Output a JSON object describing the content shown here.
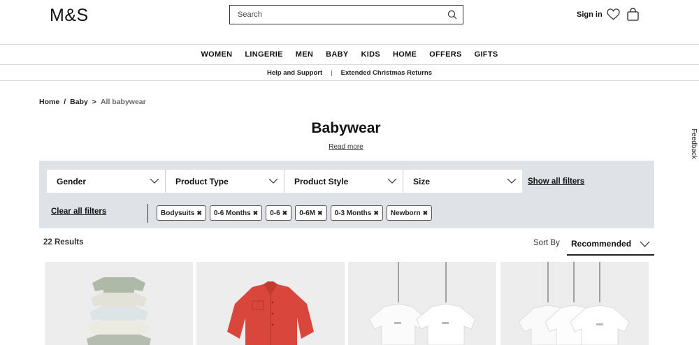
{
  "header": {
    "logo": "M&S",
    "search_placeholder": "Search",
    "sign_in": "Sign in"
  },
  "nav": {
    "items": [
      "WOMEN",
      "LINGERIE",
      "MEN",
      "BABY",
      "KIDS",
      "HOME",
      "OFFERS",
      "GIFTS"
    ]
  },
  "subnav": {
    "help": "Help and Support",
    "returns": "Extended Christmas Returns"
  },
  "breadcrumb": {
    "home": "Home",
    "sep1": "/",
    "baby": "Baby",
    "sep2": ">",
    "current": "All babywear"
  },
  "page": {
    "title": "Babywear",
    "read_more": "Read more",
    "feedback": "Feedback"
  },
  "filters": {
    "dropdowns": [
      "Gender",
      "Product Type",
      "Product Style",
      "Size"
    ],
    "show_all": "Show all filters",
    "clear_all": "Clear all filters",
    "chips": [
      "Bodysuits",
      "0-6 Months",
      "0-6",
      "0-6M",
      "0-3 Months",
      "Newborn"
    ],
    "chip_remove_glyph": "✖"
  },
  "results": {
    "count": "22 Results",
    "sort_label": "Sort By",
    "sort_value": "Recommended"
  },
  "colors": {
    "filter_bg": "#dfe2e6",
    "product_bg": "#eeeded",
    "red_shirt": "#d9463c"
  }
}
